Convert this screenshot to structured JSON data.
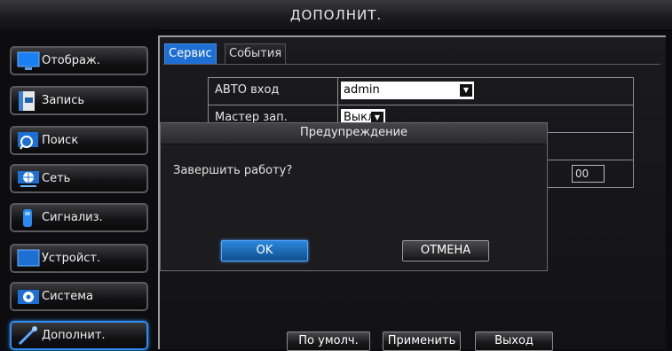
{
  "title": "ДОПОЛНИТ.",
  "sidebar": {
    "items": [
      {
        "label": "Отображ.",
        "icon": "monitor-icon"
      },
      {
        "label": "Запись",
        "icon": "record-icon"
      },
      {
        "label": "Поиск",
        "icon": "search-icon"
      },
      {
        "label": "Сеть",
        "icon": "network-icon"
      },
      {
        "label": "Сигнализ.",
        "icon": "alarm-icon"
      },
      {
        "label": "Устройст.",
        "icon": "device-icon"
      },
      {
        "label": "Система",
        "icon": "gear-icon"
      },
      {
        "label": "Дополнит.",
        "icon": "wrench-icon"
      }
    ],
    "active_index": 7
  },
  "tabs": {
    "service": "Сервис",
    "events": "События"
  },
  "settings": {
    "auto_login_label": "АВТО вход",
    "auto_login_value": "admin",
    "master_label": "Мастер зап.",
    "master_value": "Выкл.",
    "partial_value": "00"
  },
  "bottom_buttons": {
    "default": "По умолч.",
    "apply": "Применить",
    "exit": "Выход"
  },
  "dialog": {
    "title": "Предупреждение",
    "message": "Завершить работу?",
    "ok": "OK",
    "cancel": "ОТМЕНА"
  },
  "colors": {
    "accent": "#1e6fd4",
    "background": "#0b0b0d"
  }
}
